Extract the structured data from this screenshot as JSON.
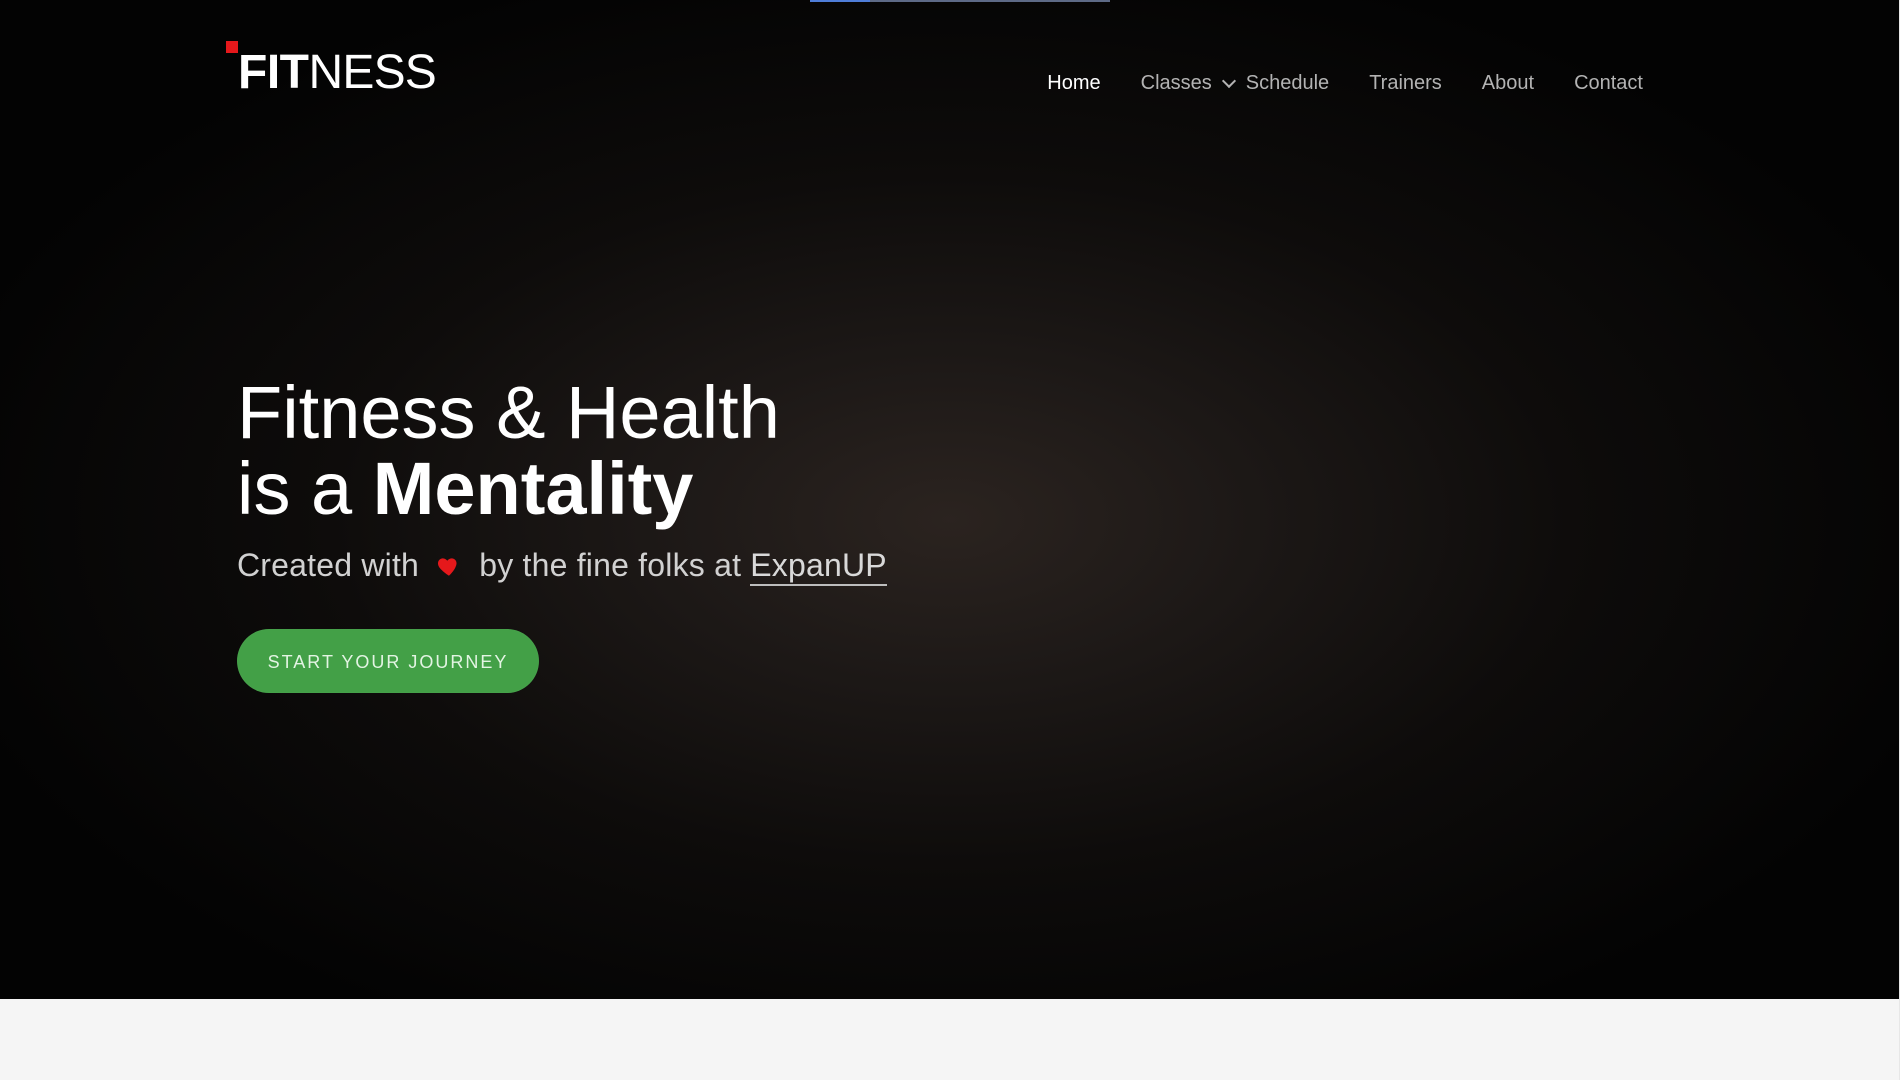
{
  "logo": {
    "bold": "FIT",
    "light": "NESS"
  },
  "nav": {
    "items": [
      "Home",
      "Classes",
      "Schedule",
      "Trainers",
      "About",
      "Contact"
    ]
  },
  "hero": {
    "headline_line1": "Fitness & Health",
    "headline_prefix": "is a ",
    "headline_emphasis": "Mentality",
    "tagline_before": "Created with",
    "tagline_middle": "by the fine folks at",
    "tagline_link": "ExpanUP",
    "cta_label": "START YOUR JOURNEY"
  },
  "colors": {
    "brand_red": "#e5181b",
    "cta_green": "#43a047",
    "heart_red": "#e5181b"
  },
  "icons": {
    "heart": "heart-icon",
    "chevron": "chevron-down-icon"
  }
}
